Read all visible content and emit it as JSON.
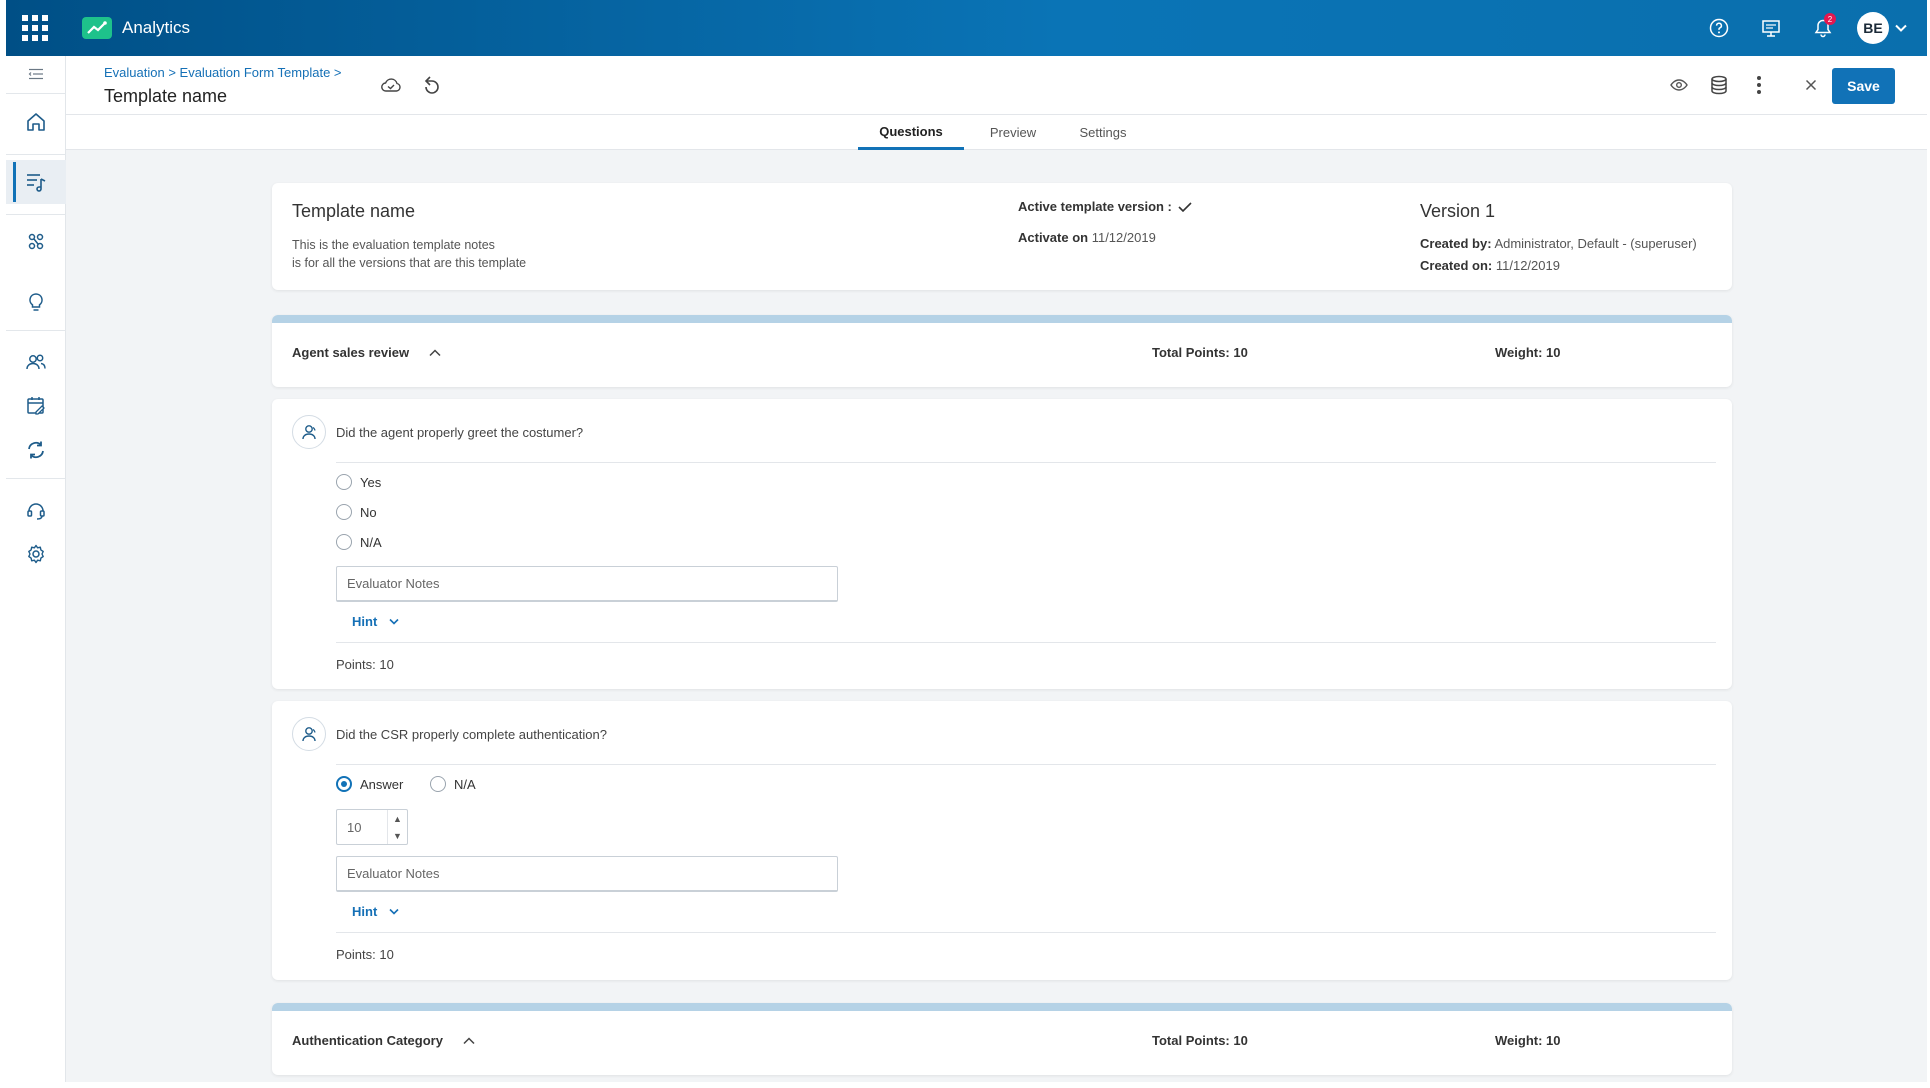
{
  "app": {
    "name": "Analytics",
    "notification_count": "2",
    "user_initials": "BE"
  },
  "header": {
    "breadcrumb": "Evaluation > Evaluation Form Template >",
    "title": "Template name",
    "save_label": "Save"
  },
  "tabs": [
    {
      "label": "Questions",
      "active": true
    },
    {
      "label": "Preview",
      "active": false
    },
    {
      "label": "Settings",
      "active": false
    }
  ],
  "template": {
    "title": "Template name",
    "notes_line1": "This is the evaluation template notes",
    "notes_line2": "is for all the versions that are this template",
    "active_version_label": "Active template version :",
    "activate_label": "Activate on",
    "activate_date": "11/12/2019",
    "version": "Version 1",
    "created_by_label": "Created by:",
    "created_by": "Administrator, Default - (superuser)",
    "created_on_label": "Created on:",
    "created_on": "11/12/2019"
  },
  "sections": [
    {
      "name": "Agent sales review",
      "total_points": "Total Points: 10",
      "weight": "Weight: 10"
    },
    {
      "name": "Authentication Category",
      "total_points": "Total Points: 10",
      "weight": "Weight: 10"
    }
  ],
  "questions": [
    {
      "text": "Did the agent properly greet the costumer?",
      "options": [
        "Yes",
        "No",
        "N/A"
      ],
      "notes_placeholder": "Evaluator Notes",
      "hint_label": "Hint",
      "points": "Points: 10"
    },
    {
      "text": "Did the CSR properly complete authentication?",
      "options": [
        "Answer",
        "N/A"
      ],
      "selected": "Answer",
      "answer_value": "10",
      "notes_placeholder": "Evaluator Notes",
      "hint_label": "Hint",
      "points": "Points: 10"
    }
  ],
  "colors": {
    "primary": "#1172b7",
    "topbar": "#0a6fad",
    "brand_green": "#1ec28b",
    "section_stripe": "#b5d2e6",
    "badge": "#e3174f"
  },
  "icons": {
    "sidebar": [
      "collapse-menu-icon",
      "home-icon",
      "evaluation-icon",
      "tools-icon",
      "lightbulb-icon",
      "users-icon",
      "calendar-edit-icon",
      "sync-icon",
      "headset-icon",
      "gear-icon"
    ],
    "topbar": [
      "apps-grid-icon",
      "help-icon",
      "presentation-icon",
      "bell-icon",
      "chevron-down-icon"
    ],
    "header": [
      "cloud-check-icon",
      "undo-icon",
      "eye-icon",
      "database-icon",
      "more-vertical-icon",
      "close-icon"
    ]
  }
}
